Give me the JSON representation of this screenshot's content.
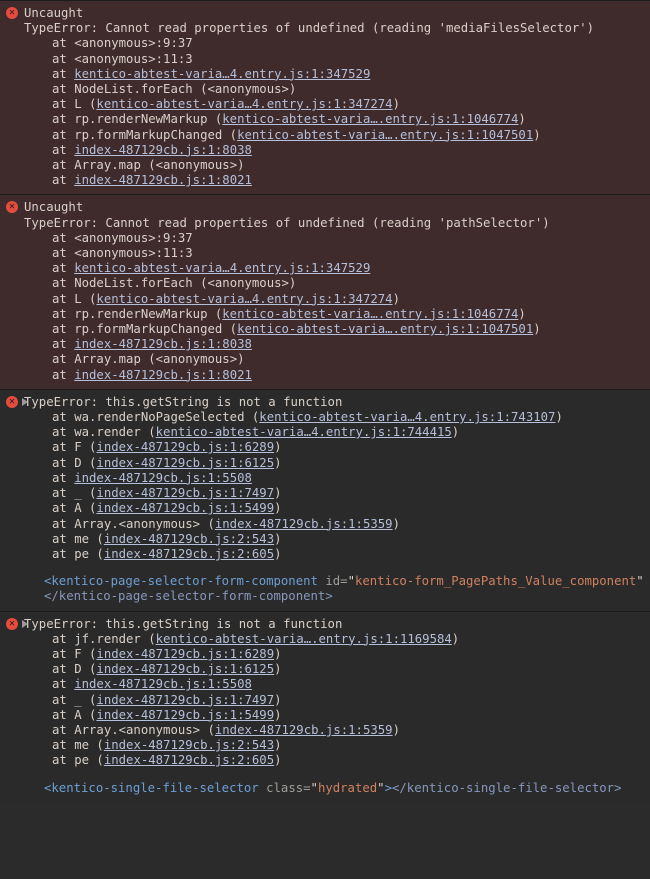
{
  "errors": [
    {
      "type": "red",
      "expandable": false,
      "header": "Uncaught",
      "message": "TypeError: Cannot read properties of undefined (reading 'mediaFilesSelector')",
      "stack": [
        {
          "prefix": "at ",
          "text": "<anonymous>:9:37"
        },
        {
          "prefix": "at ",
          "text": "<anonymous>:11:3"
        },
        {
          "prefix": "at ",
          "link": "kentico-abtest-varia…4.entry.js:1:347529"
        },
        {
          "prefix": "at ",
          "text": "NodeList.forEach (<anonymous>)"
        },
        {
          "prefix": "at L (",
          "link": "kentico-abtest-varia…4.entry.js:1:347274",
          "suffix": ")"
        },
        {
          "prefix": "at rp.renderNewMarkup (",
          "link": "kentico-abtest-varia….entry.js:1:1046774",
          "suffix": ")"
        },
        {
          "prefix": "at rp.formMarkupChanged (",
          "link": "kentico-abtest-varia….entry.js:1:1047501",
          "suffix": ")"
        },
        {
          "prefix": "at ",
          "link": "index-487129cb.js:1:8038"
        },
        {
          "prefix": "at ",
          "text": "Array.map (<anonymous>)"
        },
        {
          "prefix": "at ",
          "link": "index-487129cb.js:1:8021"
        }
      ]
    },
    {
      "type": "red",
      "expandable": false,
      "header": "Uncaught",
      "message": "TypeError: Cannot read properties of undefined (reading 'pathSelector')",
      "stack": [
        {
          "prefix": "at ",
          "text": "<anonymous>:9:37"
        },
        {
          "prefix": "at ",
          "text": "<anonymous>:11:3"
        },
        {
          "prefix": "at ",
          "link": "kentico-abtest-varia…4.entry.js:1:347529"
        },
        {
          "prefix": "at ",
          "text": "NodeList.forEach (<anonymous>)"
        },
        {
          "prefix": "at L (",
          "link": "kentico-abtest-varia…4.entry.js:1:347274",
          "suffix": ")"
        },
        {
          "prefix": "at rp.renderNewMarkup (",
          "link": "kentico-abtest-varia….entry.js:1:1046774",
          "suffix": ")"
        },
        {
          "prefix": "at rp.formMarkupChanged (",
          "link": "kentico-abtest-varia….entry.js:1:1047501",
          "suffix": ")"
        },
        {
          "prefix": "at ",
          "link": "index-487129cb.js:1:8038"
        },
        {
          "prefix": "at ",
          "text": "Array.map (<anonymous>)"
        },
        {
          "prefix": "at ",
          "link": "index-487129cb.js:1:8021"
        }
      ]
    },
    {
      "type": "dark",
      "expandable": true,
      "header": "",
      "message": "TypeError: this.getString is not a function",
      "stack": [
        {
          "prefix": "at wa.renderNoPageSelected (",
          "link": "kentico-abtest-varia…4.entry.js:1:743107",
          "suffix": ")"
        },
        {
          "prefix": "at wa.render (",
          "link": "kentico-abtest-varia…4.entry.js:1:744415",
          "suffix": ")"
        },
        {
          "prefix": "at F (",
          "link": "index-487129cb.js:1:6289",
          "suffix": ")"
        },
        {
          "prefix": "at D (",
          "link": "index-487129cb.js:1:6125",
          "suffix": ")"
        },
        {
          "prefix": "at ",
          "link": "index-487129cb.js:1:5508"
        },
        {
          "prefix": "at _ (",
          "link": "index-487129cb.js:1:7497",
          "suffix": ")"
        },
        {
          "prefix": "at A (",
          "link": "index-487129cb.js:1:5499",
          "suffix": ")"
        },
        {
          "prefix": "at Array.<anonymous> (",
          "link": "index-487129cb.js:1:5359",
          "suffix": ")"
        },
        {
          "prefix": "at me (",
          "link": "index-487129cb.js:2:543",
          "suffix": ")"
        },
        {
          "prefix": "at pe (",
          "link": "index-487129cb.js:2:605",
          "suffix": ")"
        }
      ],
      "markup": {
        "open": {
          "tag": "kentico-page-selector-form-component",
          "attr": "id",
          "val": "kentico-form_PagePaths_Value_component"
        },
        "incomplete_open": true,
        "close": "kentico-page-selector-form-component"
      }
    },
    {
      "type": "dark",
      "expandable": true,
      "header": "",
      "message": "TypeError: this.getString is not a function",
      "stack": [
        {
          "prefix": "at jf.render (",
          "link": "kentico-abtest-varia….entry.js:1:1169584",
          "suffix": ")"
        },
        {
          "prefix": "at F (",
          "link": "index-487129cb.js:1:6289",
          "suffix": ")"
        },
        {
          "prefix": "at D (",
          "link": "index-487129cb.js:1:6125",
          "suffix": ")"
        },
        {
          "prefix": "at ",
          "link": "index-487129cb.js:1:5508"
        },
        {
          "prefix": "at _ (",
          "link": "index-487129cb.js:1:7497",
          "suffix": ")"
        },
        {
          "prefix": "at A (",
          "link": "index-487129cb.js:1:5499",
          "suffix": ")"
        },
        {
          "prefix": "at Array.<anonymous> (",
          "link": "index-487129cb.js:1:5359",
          "suffix": ")"
        },
        {
          "prefix": "at me (",
          "link": "index-487129cb.js:2:543",
          "suffix": ")"
        },
        {
          "prefix": "at pe (",
          "link": "index-487129cb.js:2:605",
          "suffix": ")"
        }
      ],
      "markup": {
        "open": {
          "tag": "kentico-single-file-selector",
          "attr": "class",
          "val": "hydrated"
        },
        "incomplete_open": false,
        "close": "kentico-single-file-selector"
      }
    }
  ]
}
